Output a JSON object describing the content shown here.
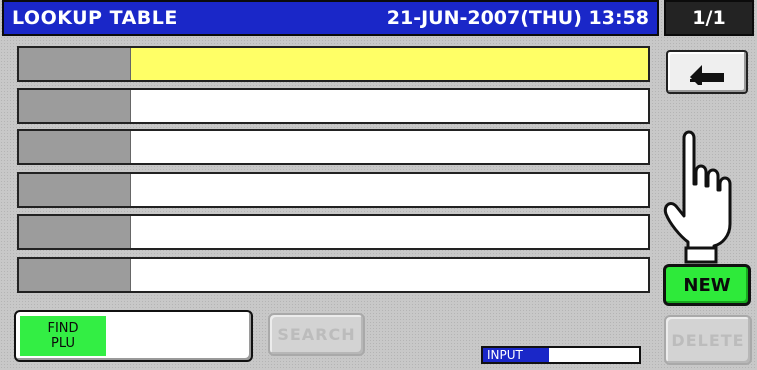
{
  "header": {
    "title": "LOOKUP TABLE",
    "datetime": "21-JUN-2007(THU) 13:58",
    "page": "1/1"
  },
  "rows": [
    {
      "key": "",
      "value": "",
      "selected": true
    },
    {
      "key": "",
      "value": ""
    },
    {
      "key": "",
      "value": ""
    },
    {
      "key": "",
      "value": ""
    },
    {
      "key": "",
      "value": ""
    },
    {
      "key": "",
      "value": ""
    }
  ],
  "buttons": {
    "back_icon": "return-arrow-icon",
    "new_label": "NEW",
    "find_plu_line1": "FIND",
    "find_plu_line2": "PLU",
    "search_label": "SEARCH",
    "delete_label": "DELETE"
  },
  "input": {
    "label": "INPUT",
    "value": ""
  },
  "icons": {
    "hand": "pointing-hand-icon"
  },
  "colors": {
    "titlebar": "#1a27c8",
    "selected_row": "#ffff66",
    "new_button": "#2eea3a",
    "find_plu_tag": "#33ee44",
    "disabled_text": "#bcbcbc"
  }
}
